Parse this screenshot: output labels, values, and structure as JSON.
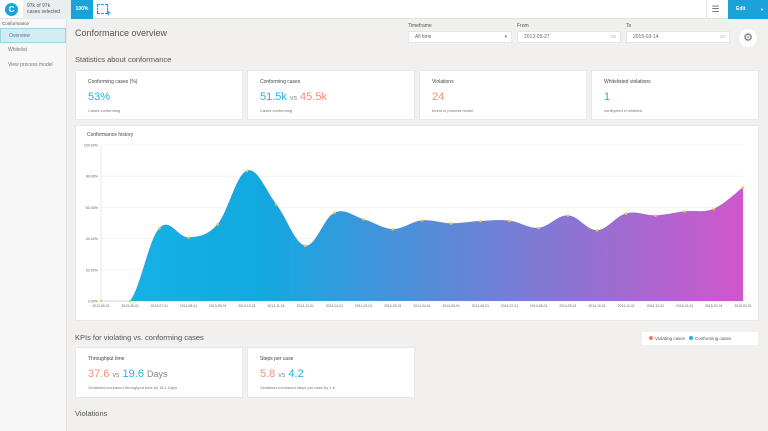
{
  "topbar": {
    "logo_letter": "C",
    "selection_line1": "97k of 97k",
    "selection_line2": "cases selected",
    "percent": "100%",
    "add_selection_icon": "add-selection-icon",
    "menu_icon": "hamburger-icon",
    "edit_label": "Edit"
  },
  "sidebar": {
    "section": "Conformance",
    "items": [
      {
        "label": "Overview",
        "active": true
      },
      {
        "label": "Whitelist"
      },
      {
        "label": "View process model"
      }
    ]
  },
  "header": {
    "title": "Conformance overview",
    "timeframe_label": "Timeframe",
    "timeframe_value": "All time",
    "from_label": "From",
    "from_value": "2013-05-27",
    "to_label": "To",
    "to_value": "2015-03-14"
  },
  "stats": {
    "heading": "Statistics about conformance",
    "cards": [
      {
        "title": "Conforming cases (%)",
        "value": "53%",
        "sub": "Cases conforming"
      },
      {
        "title": "Conforming cases",
        "value_a": "51.5k",
        "vs": "vs",
        "value_b": "45.5k",
        "sub": "Cases conforming"
      },
      {
        "title": "Violations",
        "value": "24",
        "sub": "found in process model"
      },
      {
        "title": "Whitelisted violations",
        "value": "1",
        "sub": "configured in whitelist"
      }
    ]
  },
  "chart_data": {
    "type": "area",
    "title": "Conformance history",
    "x": [
      "2013-05-01",
      "2013-06-01",
      "2013-07-01",
      "2013-08-01",
      "2013-09-01",
      "2013-10-01",
      "2013-11-01",
      "2013-12-01",
      "2014-01-01",
      "2014-02-01",
      "2014-03-01",
      "2014-04-01",
      "2014-05-01",
      "2014-06-01",
      "2014-07-01",
      "2014-08-01",
      "2014-09-01",
      "2014-10-01",
      "2014-11-01",
      "2014-12-01",
      "2015-01-01",
      "2015-02-01",
      "2015-03-01"
    ],
    "values": [
      0,
      0,
      46.6,
      40.7,
      49.2,
      83.5,
      62,
      35.4,
      56.5,
      52.3,
      46,
      51.6,
      49.7,
      51.2,
      51.4,
      46.8,
      54.8,
      45.3,
      56.1,
      54.8,
      57.4,
      59,
      72.8
    ],
    "yticks": [
      "0.00%",
      "20.00%",
      "40.00%",
      "60.00%",
      "80.00%",
      "100.00%"
    ],
    "ylim": [
      0,
      100
    ],
    "grid": true,
    "gradient": [
      "#16b4e6",
      "#d156cc"
    ],
    "marker_color": "#f7c948"
  },
  "kpis": {
    "heading": "KPIs for violating vs. conforming cases",
    "legend": [
      {
        "label": "Violating cases",
        "color": "#f77b72"
      },
      {
        "label": "Conforming cases",
        "color": "#1fb5e3"
      }
    ],
    "cards": [
      {
        "title": "Throughput time",
        "value_a": "37.6",
        "vs": "vs",
        "value_b": "19.6",
        "unit": "Days",
        "sub": "Violations increased throughput time by 18.1 Days"
      },
      {
        "title": "Steps per case",
        "value_a": "5.8",
        "vs": "vs",
        "value_b": "4.2",
        "sub": "Violations increased steps per case by 1.6"
      }
    ]
  },
  "violations": {
    "heading": "Violations"
  }
}
